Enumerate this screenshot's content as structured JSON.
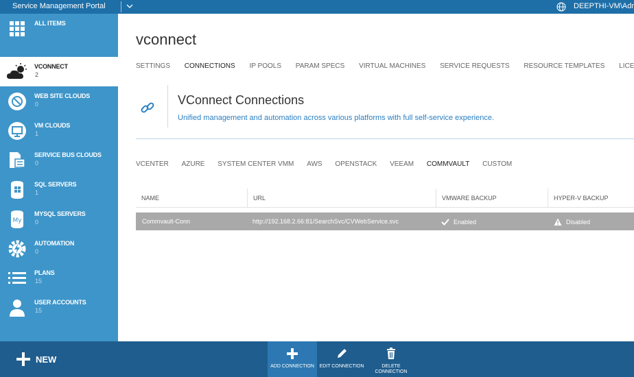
{
  "topbar": {
    "title": "Service Management Portal",
    "user": "DEEPTHI-VM\\Adm"
  },
  "sidebar": {
    "items": [
      {
        "label": "ALL ITEMS",
        "count": "",
        "icon": "grid-icon",
        "active": false
      },
      {
        "label": "VCONNECT",
        "count": "2",
        "icon": "cloud-sun-icon",
        "active": true
      },
      {
        "label": "WEB SITE CLOUDS",
        "count": "0",
        "icon": "globe-icon",
        "active": false
      },
      {
        "label": "VM CLOUDS",
        "count": "1",
        "icon": "monitor-icon",
        "active": false
      },
      {
        "label": "SERVICE BUS CLOUDS",
        "count": "0",
        "icon": "service-bus-icon",
        "active": false
      },
      {
        "label": "SQL SERVERS",
        "count": "1",
        "icon": "database-icon",
        "active": false
      },
      {
        "label": "MYSQL SERVERS",
        "count": "0",
        "icon": "mysql-icon",
        "active": false
      },
      {
        "label": "AUTOMATION",
        "count": "0",
        "icon": "gear-lightning-icon",
        "active": false
      },
      {
        "label": "PLANS",
        "count": "15",
        "icon": "list-icon",
        "active": false
      },
      {
        "label": "USER ACCOUNTS",
        "count": "15",
        "icon": "user-icon",
        "active": false
      }
    ]
  },
  "main": {
    "title": "vconnect",
    "tabs": [
      "SETTINGS",
      "CONNECTIONS",
      "IP POOLS",
      "PARAM SPECS",
      "VIRTUAL MACHINES",
      "SERVICE REQUESTS",
      "RESOURCE TEMPLATES",
      "LICENSE"
    ],
    "active_tab": "CONNECTIONS",
    "banner": {
      "title": "VConnect Connections",
      "subtitle": "Unified management and automation across various platforms with full self-service experience."
    },
    "subtabs": [
      "VCENTER",
      "AZURE",
      "SYSTEM CENTER VMM",
      "AWS",
      "OPENSTACK",
      "VEEAM",
      "COMMVAULT",
      "CUSTOM"
    ],
    "active_subtab": "COMMVAULT",
    "grid": {
      "columns": [
        "NAME",
        "URL",
        "VMWARE BACKUP",
        "HYPER-V BACKUP"
      ],
      "rows": [
        {
          "name": "Commvault-Conn",
          "url": "http://192.168.2.66:81/SearchSvc/CVWebService.svc",
          "vmware": "Enabled",
          "hyperv": "Disabled"
        }
      ]
    }
  },
  "bottombar": {
    "new_label": "NEW",
    "commands": [
      {
        "label": "ADD CONNECTION",
        "icon": "plus-icon"
      },
      {
        "label": "EDIT CONNECTION",
        "icon": "pencil-icon"
      },
      {
        "label": "DELETE CONNECTION",
        "icon": "trash-icon"
      }
    ]
  },
  "colors": {
    "topbar": "#1e6fa8",
    "sidebar": "#3e95c9",
    "bottombar": "#1f5d8e",
    "accent_link": "#2a7fc1",
    "selected_row": "#a9a9a9"
  }
}
